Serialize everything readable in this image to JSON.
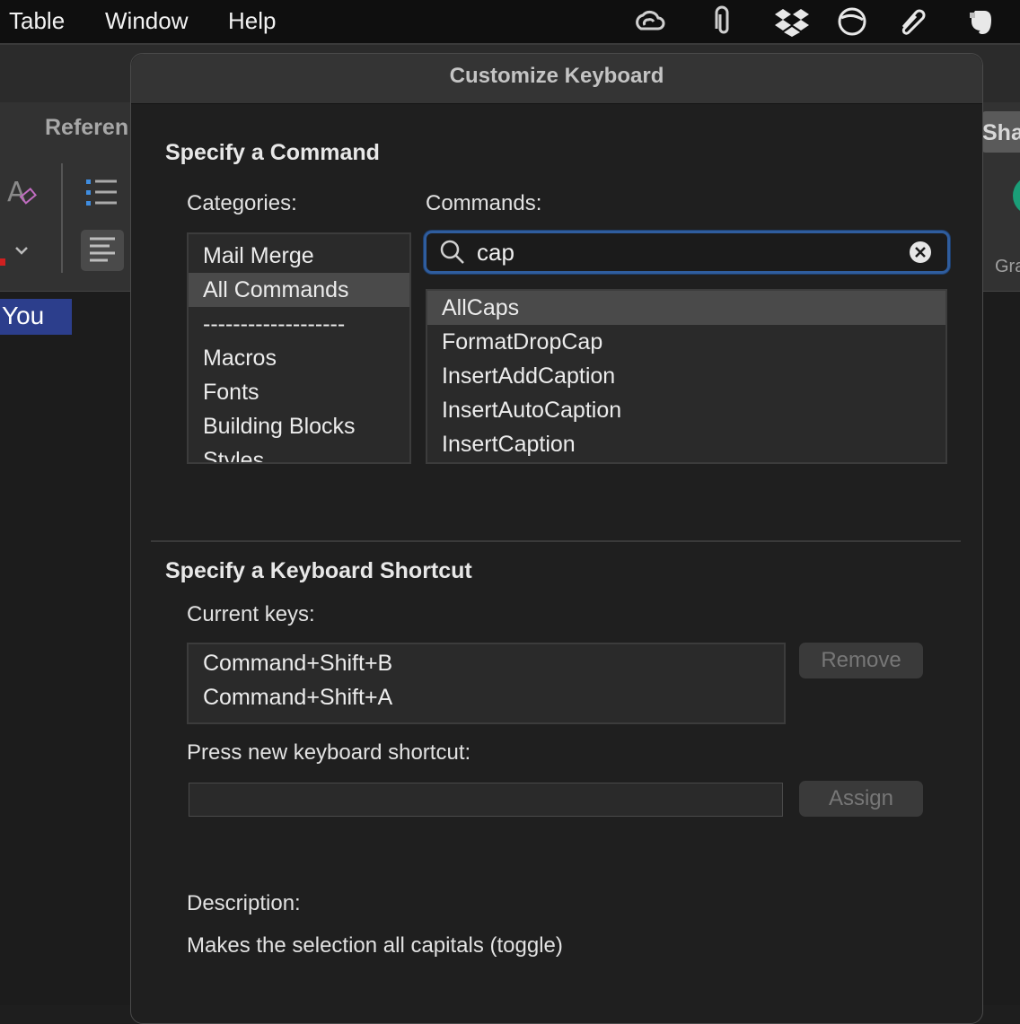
{
  "menubar": {
    "items": [
      "Table",
      "Window",
      "Help"
    ],
    "tray_icons": [
      "creative-cloud-icon",
      "paperclip-icon",
      "dropbox-icon",
      "sync-icon",
      "attachment-icon",
      "evernote-icon"
    ]
  },
  "background_app": {
    "tab_label": "Referen",
    "share_label": "Sha",
    "right_label": "Gra",
    "doc_text": "You"
  },
  "dialog": {
    "title": "Customize Keyboard",
    "command_section": {
      "title": "Specify a Command",
      "categories_label": "Categories:",
      "categories": [
        "Mail Merge",
        "All Commands",
        "-------------------",
        "Macros",
        "Fonts",
        "Building Blocks",
        "Styles"
      ],
      "selected_category": "All Commands",
      "commands_label": "Commands:",
      "search_value": "cap",
      "commands": [
        "AllCaps",
        "FormatDropCap",
        "InsertAddCaption",
        "InsertAutoCaption",
        "InsertCaption"
      ],
      "selected_command": "AllCaps"
    },
    "shortcut_section": {
      "title": "Specify a Keyboard Shortcut",
      "current_keys_label": "Current keys:",
      "current_keys": [
        "Command+Shift+B",
        "Command+Shift+A"
      ],
      "remove_label": "Remove",
      "new_shortcut_label": "Press new keyboard shortcut:",
      "new_shortcut_value": "",
      "assign_label": "Assign"
    },
    "description": {
      "label": "Description:",
      "text": "Makes the selection all capitals (toggle)"
    }
  },
  "colors": {
    "accent": "#2f5d9e",
    "selection": "#4a4a4a",
    "doc_highlight": "#2c3e8c"
  }
}
